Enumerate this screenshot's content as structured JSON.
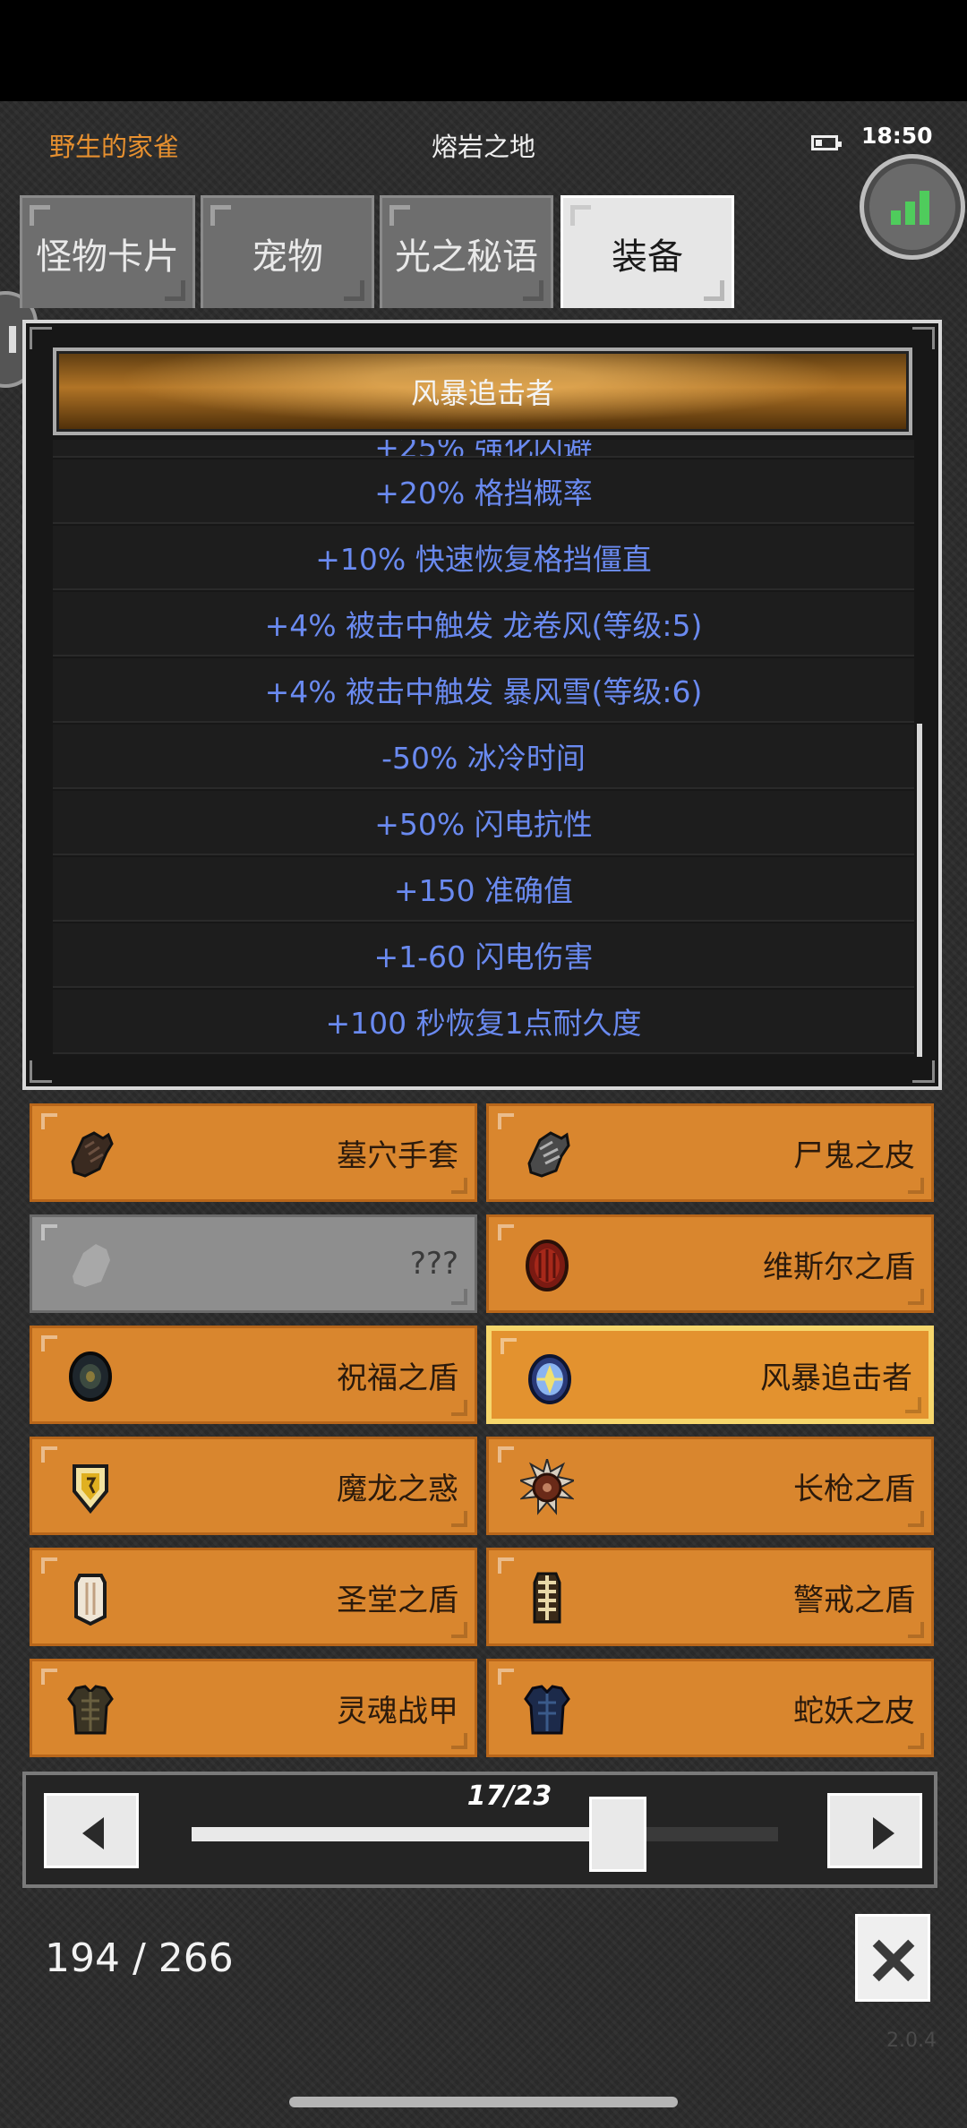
{
  "status": {
    "player_name": "野生的家雀",
    "zone_name": "熔岩之地",
    "time": "18:50"
  },
  "tabs": [
    {
      "label": "怪物卡片",
      "active": false
    },
    {
      "label": "宠物",
      "active": false
    },
    {
      "label": "光之秘语",
      "active": false
    },
    {
      "label": "装备",
      "active": true
    }
  ],
  "detail": {
    "title": "风暴追击者",
    "stats": [
      "+20% 格挡概率",
      "+10% 快速恢复格挡僵直",
      "+4% 被击中触发 龙卷风(等级:5)",
      "+4% 被击中触发 暴风雪(等级:6)",
      "-50% 冰冷时间",
      "+50% 闪电抗性",
      "+150 准确值",
      "+1-60 闪电伤害",
      "+100 秒恢复1点耐久度"
    ]
  },
  "items": [
    {
      "name": "墓穴手套",
      "icon": "glove-icon",
      "state": "normal"
    },
    {
      "name": "尸鬼之皮",
      "icon": "gauntlet-icon",
      "state": "normal"
    },
    {
      "name": "???",
      "icon": "unknown-item-icon",
      "state": "locked"
    },
    {
      "name": "维斯尔之盾",
      "icon": "round-red-shield-icon",
      "state": "normal"
    },
    {
      "name": "祝福之盾",
      "icon": "dark-round-shield-icon",
      "state": "normal"
    },
    {
      "name": "风暴追击者",
      "icon": "storm-shield-icon",
      "state": "selected"
    },
    {
      "name": "魔龙之惑",
      "icon": "dragon-shield-icon",
      "state": "normal"
    },
    {
      "name": "长枪之盾",
      "icon": "spiked-shield-icon",
      "state": "normal"
    },
    {
      "name": "圣堂之盾",
      "icon": "tower-shield-icon",
      "state": "normal"
    },
    {
      "name": "警戒之盾",
      "icon": "bone-shield-icon",
      "state": "normal"
    },
    {
      "name": "灵魂战甲",
      "icon": "dark-armor-icon",
      "state": "normal"
    },
    {
      "name": "蛇妖之皮",
      "icon": "blue-armor-icon",
      "state": "normal"
    }
  ],
  "pager": {
    "label": "17/23",
    "current": 17,
    "total": 23
  },
  "collection_count": "194 / 266",
  "version": "2.0.4",
  "colors": {
    "accent_orange": "#d9862e",
    "stat_blue": "#6a8af0",
    "selected_border": "#f6d76c",
    "player_name": "#e7902f",
    "signal_green": "#4fcc5c"
  }
}
